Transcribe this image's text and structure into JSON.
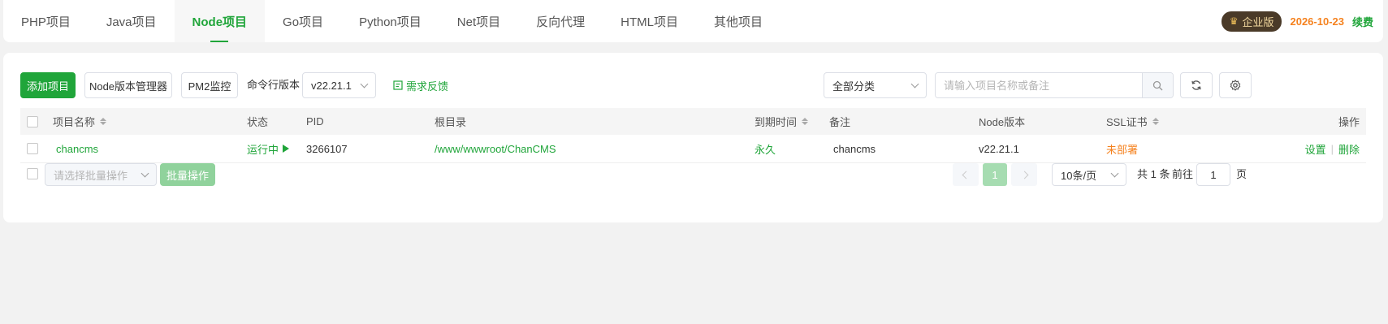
{
  "tabs": [
    {
      "label": "PHP项目",
      "active": false
    },
    {
      "label": "Java项目",
      "active": false
    },
    {
      "label": "Node项目",
      "active": true
    },
    {
      "label": "Go项目",
      "active": false
    },
    {
      "label": "Python项目",
      "active": false
    },
    {
      "label": "Net项目",
      "active": false
    },
    {
      "label": "反向代理",
      "active": false
    },
    {
      "label": "HTML项目",
      "active": false
    },
    {
      "label": "其他项目",
      "active": false
    }
  ],
  "account": {
    "edition_label": "企业版",
    "expire_date": "2026-10-23",
    "renew_label": "续费"
  },
  "toolbar": {
    "add_project": "添加项目",
    "node_version_manager": "Node版本管理器",
    "pm2_monitor": "PM2监控",
    "cli_version_label": "命令行版本",
    "cli_version_value": "v22.21.1",
    "feedback": "需求反馈",
    "category_value": "全部分类",
    "search_placeholder": "请输入项目名称或备注"
  },
  "table": {
    "headers": {
      "name": "项目名称",
      "status": "状态",
      "pid": "PID",
      "root": "根目录",
      "expire": "到期时间",
      "remark": "备注",
      "node_version": "Node版本",
      "ssl": "SSL证书",
      "actions": "操作"
    },
    "rows": [
      {
        "name": "chancms",
        "status": "运行中",
        "pid": "3266107",
        "root": "/www/wwwroot/ChanCMS",
        "expire": "永久",
        "remark": "chancms",
        "node_version": "v22.21.1",
        "ssl": "未部署",
        "action_settings": "设置",
        "action_delete": "删除"
      }
    ]
  },
  "footer": {
    "batch_placeholder": "请选择批量操作",
    "batch_button": "批量操作",
    "current_page": "1",
    "page_size": "10条/页",
    "total": "共 1 条",
    "goto_label": "前往",
    "goto_value": "1",
    "page_unit": "页"
  },
  "colors": {
    "accent": "#20a53a",
    "warning": "#f5821f"
  }
}
